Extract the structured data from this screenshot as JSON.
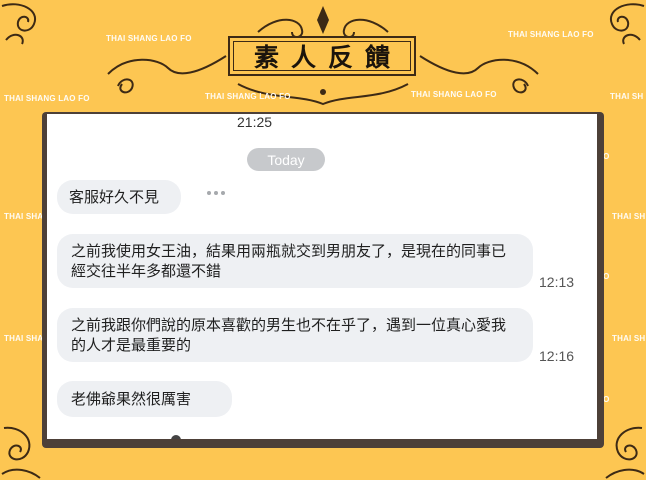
{
  "banner": {
    "title": "素人反饋"
  },
  "watermark": {
    "text": "THAI SHANG LAO FO",
    "short_left": "THAI SHAN",
    "short_right": "THAI SH",
    "short_tail": "FO",
    "short_mid": "THAI SHA"
  },
  "chat": {
    "status_time": "21:25",
    "date_separator": "Today",
    "messages": [
      {
        "text": "客服好久不見",
        "time": ""
      },
      {
        "text": "之前我使用女王油，結果用兩瓶就交到男朋友了，是現在的同事已經交往半年多都還不錯",
        "time": "12:13"
      },
      {
        "text": "之前我跟你們說的原本喜歡的男生也不在乎了，遇到一位真心愛我的人才是最重要的",
        "time": "12:16"
      },
      {
        "text": "老佛爺果然很厲害",
        "time": ""
      }
    ]
  },
  "colors": {
    "background": "#fdc652",
    "frame": "#4d4038",
    "bubble": "#eef0f3",
    "pill": "#c7c9cc"
  }
}
